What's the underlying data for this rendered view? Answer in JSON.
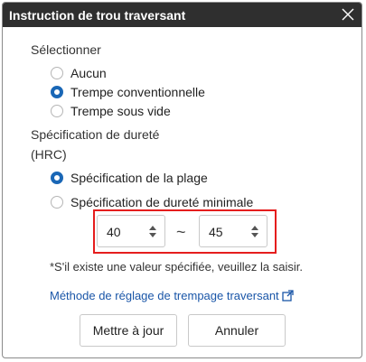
{
  "dialog": {
    "title": "Instruction de trou traversant"
  },
  "select_section": {
    "label": "Sélectionner",
    "options": [
      {
        "label": "Aucun",
        "checked": false
      },
      {
        "label": "Trempe conventionnelle",
        "checked": true
      },
      {
        "label": "Trempe sous vide",
        "checked": false
      }
    ]
  },
  "hardness_section": {
    "label_line1": "Spécification de dureté",
    "label_line2": "(HRC)",
    "options": [
      {
        "label": "Spécification de la plage",
        "checked": true
      },
      {
        "label": "Spécification de dureté minimale",
        "checked": false
      }
    ],
    "range": {
      "min_value": "40",
      "separator": "~",
      "max_value": "45"
    }
  },
  "note": "*S'il existe une valeur spécifiée, veuillez la saisir.",
  "link": {
    "label": "Méthode de réglage de trempage traversant",
    "icon": "external-link-icon"
  },
  "buttons": {
    "update_label": "Mettre à jour",
    "cancel_label": "Annuler"
  },
  "colors": {
    "titlebar": "#2f2f2f",
    "accent": "#1a67b6",
    "link": "#1a56a8",
    "highlight_border": "#e51d1d"
  }
}
